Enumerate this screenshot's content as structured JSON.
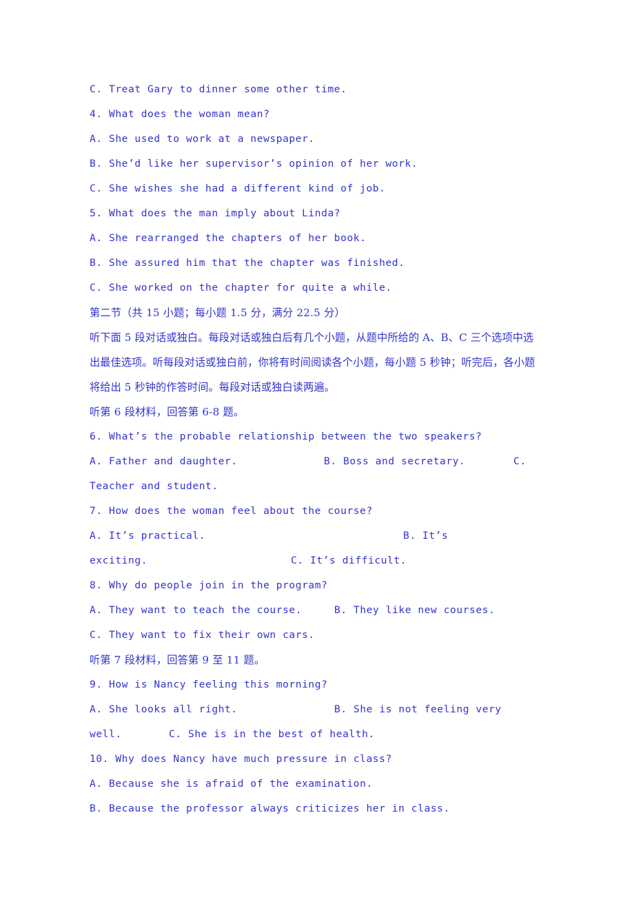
{
  "page": {
    "text_color": "#3333cc",
    "background_color": "#ffffff"
  },
  "lines": {
    "q3_option_c": "C. Treat Gary to dinner some other time.",
    "q4_stem": "4. What does the woman mean?",
    "q4_option_a": "A. She used to work at a newspaper.",
    "q4_option_b": "B. She’d like her supervisor’s opinion of her work.",
    "q4_option_c": "C. She wishes she had a different kind of job.",
    "q5_stem": "5. What does the man imply about Linda?",
    "q5_option_a": "A. She rearranged the chapters of her book.",
    "q5_option_b": "B. She assured him that the chapter was finished.",
    "q5_option_c": "C. She worked on the chapter for quite a while.",
    "section_two_heading": "第二节（共 15 小题；每小题 1.5 分，满分 22.5 分）",
    "instructions_line1": "听下面 5 段对话或独白。每段对话或独白后有几个小题，从题中所给的 A、B、C 三个选项中选",
    "instructions_line2": "出最佳选项。听每段对话或独白前，你将有时间阅读各个小题，每小题 5 秒钟；听完后，各小题",
    "instructions_line3": "将给出 5 秒钟的作答时间。每段对话或独白读两遍。",
    "material6_heading": "听第 6 段材料，回答第 6-8 题。",
    "q6_stem": "6. What’s the probable relationship between the two speakers?",
    "q6_option_a": "A. Father and daughter.",
    "q6_option_b": "B. Boss and secretary.",
    "q6_option_c_label": "C.",
    "q6_option_c_cont": "Teacher and student.",
    "q7_stem": "7. How does the woman feel about the course?",
    "q7_option_a": "A. It’s practical.",
    "q7_option_b_part1": "B. It’s",
    "q7_option_b_part2": "exciting.",
    "q7_option_c": "C. It’s difficult.",
    "q8_stem": "8. Why do people join in the program?",
    "q8_option_a": "A. They want to teach the course.",
    "q8_option_b": "B. They like new courses.",
    "q8_option_c": "C. They want to fix their own cars.",
    "material7_heading": "听第 7 段材料，回答第 9 至 11 题。",
    "q9_stem": "9. How is Nancy feeling this morning?",
    "q9_option_a": "A. She looks all right.",
    "q9_option_b_part1": "B. She is not feeling very",
    "q9_option_b_part2": "well.",
    "q9_option_c": "C. She is in the best of health.",
    "q10_stem": "10. Why does Nancy have much pressure in class?",
    "q10_option_a": "A. Because she is afraid of the examination.",
    "q10_option_b": "B. Because the professor always criticizes her in class."
  }
}
